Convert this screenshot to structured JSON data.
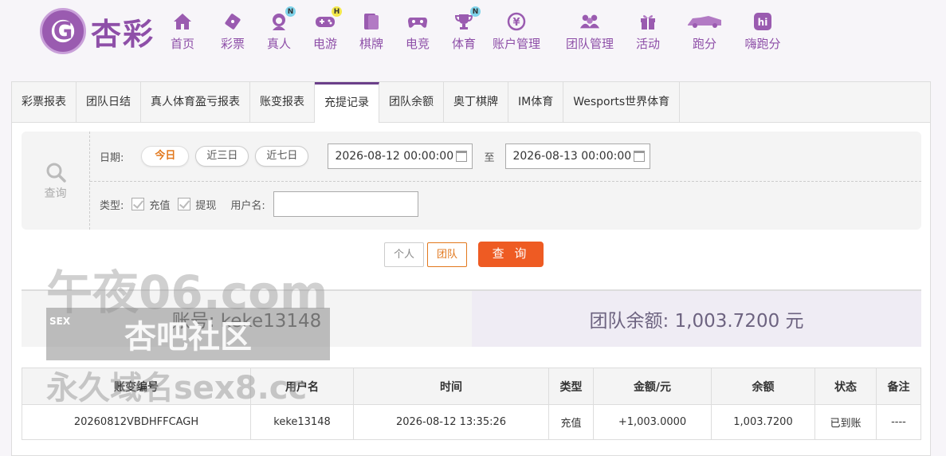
{
  "brand": {
    "logo_text": "杏彩",
    "emblem": "G"
  },
  "nav": [
    {
      "label": "首页",
      "icon": "home-icon",
      "badge": ""
    },
    {
      "label": "彩票",
      "icon": "ticket-icon",
      "badge": ""
    },
    {
      "label": "真人",
      "icon": "live-dealer-icon",
      "badge": "N"
    },
    {
      "label": "电游",
      "icon": "gamepad-icon",
      "badge": "H"
    },
    {
      "label": "棋牌",
      "icon": "cards-icon",
      "badge": ""
    },
    {
      "label": "电竞",
      "icon": "esports-controller-icon",
      "badge": ""
    },
    {
      "label": "体育",
      "icon": "trophy-icon",
      "badge": "N"
    },
    {
      "label": "账户管理",
      "icon": "yen-coin-icon",
      "badge": ""
    },
    {
      "label": "团队管理",
      "icon": "team-icon",
      "badge": ""
    },
    {
      "label": "活动",
      "icon": "gift-icon",
      "badge": ""
    },
    {
      "label": "跑分",
      "icon": "race-car-icon",
      "badge": ""
    },
    {
      "label": "嗨跑分",
      "icon": "hi-app-icon",
      "badge": ""
    }
  ],
  "tabs": [
    "彩票报表",
    "团队日结",
    "真人体育盈亏报表",
    "账变报表",
    "充提记录",
    "团队余额",
    "奥丁棋牌",
    "IM体育",
    "Wesports世界体育"
  ],
  "active_tab": "充提记录",
  "search": {
    "side_label": "查询",
    "date_label": "日期:",
    "quick": [
      "今日",
      "近三日",
      "近七日"
    ],
    "start": "2026-08-12 00:00:00",
    "to": "至",
    "end": "2026-08-13 00:00:00",
    "type_label": "类型:",
    "types": [
      "充值",
      "提现"
    ],
    "username_label": "用户名:",
    "username_value": ""
  },
  "buttons": {
    "personal": "个人",
    "team": "团队",
    "query": "查 询"
  },
  "summary": {
    "account": "账号: keke13148",
    "balance": "团队余额: 1,003.7200 元"
  },
  "table": {
    "headers": [
      "账变编号",
      "用户名",
      "时间",
      "类型",
      "金额/元",
      "余额",
      "状态",
      "备注"
    ],
    "rows": [
      [
        "20260812VBDHFFCAGH",
        "keke13148",
        "2026-08-12 13:35:26",
        "充值",
        "+1,003.0000",
        "1,003.7200",
        "已到账",
        "----"
      ]
    ]
  },
  "watermark": {
    "line1": "午夜06.com",
    "tag": "SEX",
    "line2": "杏吧社区",
    "line3": "永久域名sex8.cc"
  }
}
